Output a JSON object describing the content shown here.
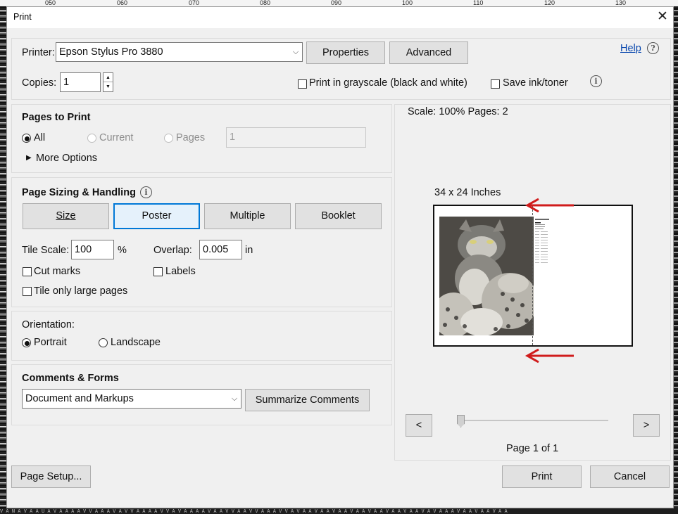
{
  "ruler": [
    "050",
    "060",
    "070",
    "080",
    "090",
    "100",
    "110",
    "120",
    "130"
  ],
  "window": {
    "title": "Print",
    "close_label": "✕"
  },
  "printer": {
    "label": "Printer:",
    "selected": "Epson Stylus Pro 3880",
    "properties_label": "Properties",
    "advanced_label": "Advanced",
    "help_label": "Help"
  },
  "copies": {
    "label": "Copies:",
    "value": "1"
  },
  "options": {
    "grayscale_label": "Print in grayscale (black and white)",
    "save_ink_label": "Save ink/toner"
  },
  "pages_to_print": {
    "title": "Pages to Print",
    "all_label": "All",
    "current_label": "Current",
    "pages_label": "Pages",
    "pages_value": "1",
    "more_options_label": "More Options"
  },
  "sizing": {
    "title": "Page Sizing & Handling",
    "size_label": "Size",
    "poster_label": "Poster",
    "multiple_label": "Multiple",
    "booklet_label": "Booklet",
    "tile_scale_label": "Tile Scale:",
    "tile_scale_value": "100",
    "tile_scale_unit": "%",
    "overlap_label": "Overlap:",
    "overlap_value": "0.005",
    "overlap_unit": "in",
    "cut_marks_label": "Cut marks",
    "labels_label": "Labels",
    "tile_large_label": "Tile only large pages"
  },
  "orientation": {
    "title": "Orientation:",
    "portrait_label": "Portrait",
    "landscape_label": "Landscape"
  },
  "comments": {
    "title": "Comments & Forms",
    "selected": "Document and Markups",
    "summarize_label": "Summarize Comments"
  },
  "preview": {
    "scale_text": "Scale: 100% Pages: 2",
    "size_text": "34 x 24 Inches",
    "prev_label": "<",
    "next_label": ">",
    "page_text": "Page 1 of 1",
    "slider_position": 0
  },
  "footer": {
    "page_setup_label": "Page Setup...",
    "print_label": "Print",
    "cancel_label": "Cancel"
  },
  "colors": {
    "accent": "#0078d7",
    "arrow_red": "#d01c1c",
    "link": "#0645ad"
  }
}
